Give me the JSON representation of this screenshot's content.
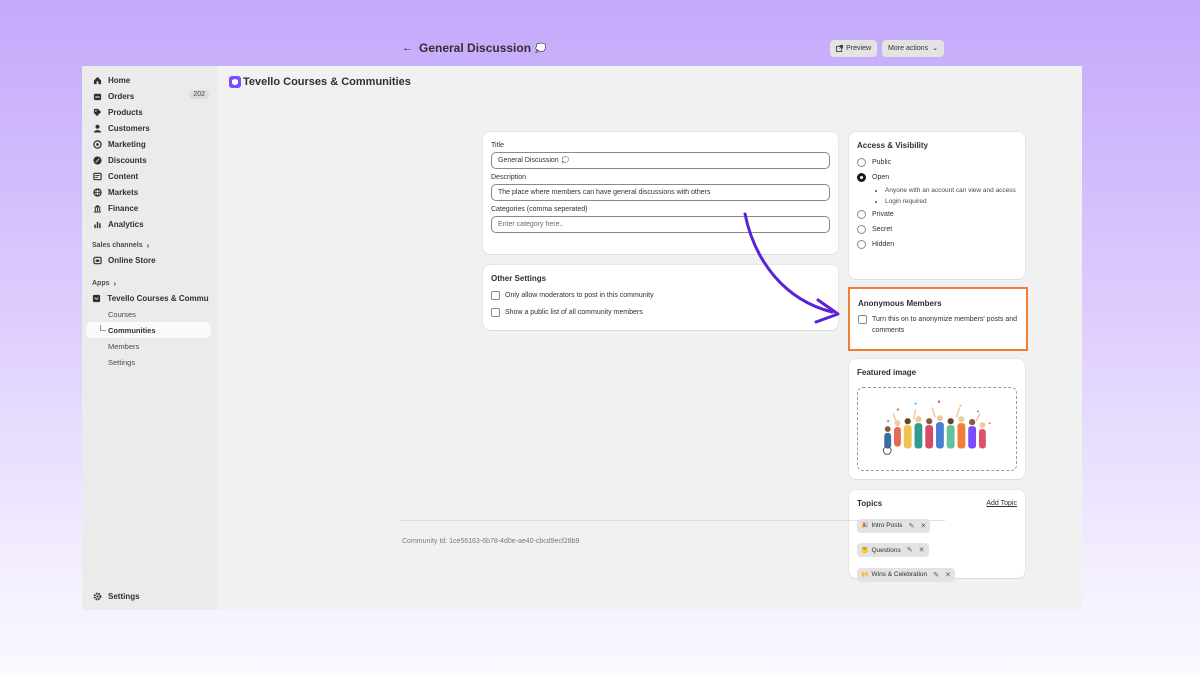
{
  "app": {
    "title": "Tevello Courses & Communities"
  },
  "sidebar": {
    "items": [
      {
        "label": "Home",
        "icon": "home-icon"
      },
      {
        "label": "Orders",
        "icon": "orders-icon",
        "badge": "202"
      },
      {
        "label": "Products",
        "icon": "tag-icon"
      },
      {
        "label": "Customers",
        "icon": "person-icon"
      },
      {
        "label": "Marketing",
        "icon": "target-icon"
      },
      {
        "label": "Discounts",
        "icon": "discount-icon"
      },
      {
        "label": "Content",
        "icon": "content-icon"
      },
      {
        "label": "Markets",
        "icon": "globe-icon"
      },
      {
        "label": "Finance",
        "icon": "bank-icon"
      },
      {
        "label": "Analytics",
        "icon": "bar-chart-icon"
      }
    ],
    "sales_channels_label": "Sales channels",
    "online_store_label": "Online Store",
    "apps_label": "Apps",
    "app_item_label": "Tevello Courses & Commu...",
    "app_sub_items": [
      "Courses",
      "Communities",
      "Members",
      "Settings"
    ],
    "settings_label": "Settings"
  },
  "page": {
    "title": "General Discussion",
    "preview_label": "Preview",
    "more_actions_label": "More actions"
  },
  "form": {
    "title_label": "Title",
    "title_value": "General Discussion",
    "description_label": "Description",
    "description_value": "The place where members can have general discussions with others",
    "categories_label": "Categories (comma seperated)",
    "categories_placeholder": "Enter category here.."
  },
  "other_settings": {
    "title": "Other Settings",
    "options": [
      "Only allow moderators to post in this community",
      "Show a public list of all community members"
    ]
  },
  "access": {
    "title": "Access & Visibility",
    "public": "Public",
    "open": "Open",
    "open_bullets": [
      "Anyone with an account can view and access",
      "Login required"
    ],
    "private": "Private",
    "secret": "Secret",
    "hidden": "Hidden",
    "selected": "Open"
  },
  "anonymous": {
    "title": "Anonymous Members",
    "option": "Turn this on to anonymize members' posts and comments"
  },
  "featured": {
    "title": "Featured image"
  },
  "topics": {
    "title": "Topics",
    "add_label": "Add Topic",
    "items": [
      {
        "emoji": "🎉",
        "label": "Intro Posts"
      },
      {
        "emoji": "🤔",
        "label": "Questions"
      },
      {
        "emoji": "🙌",
        "label": "Wins & Celebration"
      }
    ]
  },
  "footer": {
    "community_id": "Community Id: 1ce56163-6b78-4d0e-ae40-cbcd9ecf28b9"
  },
  "colors": {
    "highlight": "#f07f35",
    "arrow": "#5b21d6",
    "background_top": "#c4a8fb"
  }
}
